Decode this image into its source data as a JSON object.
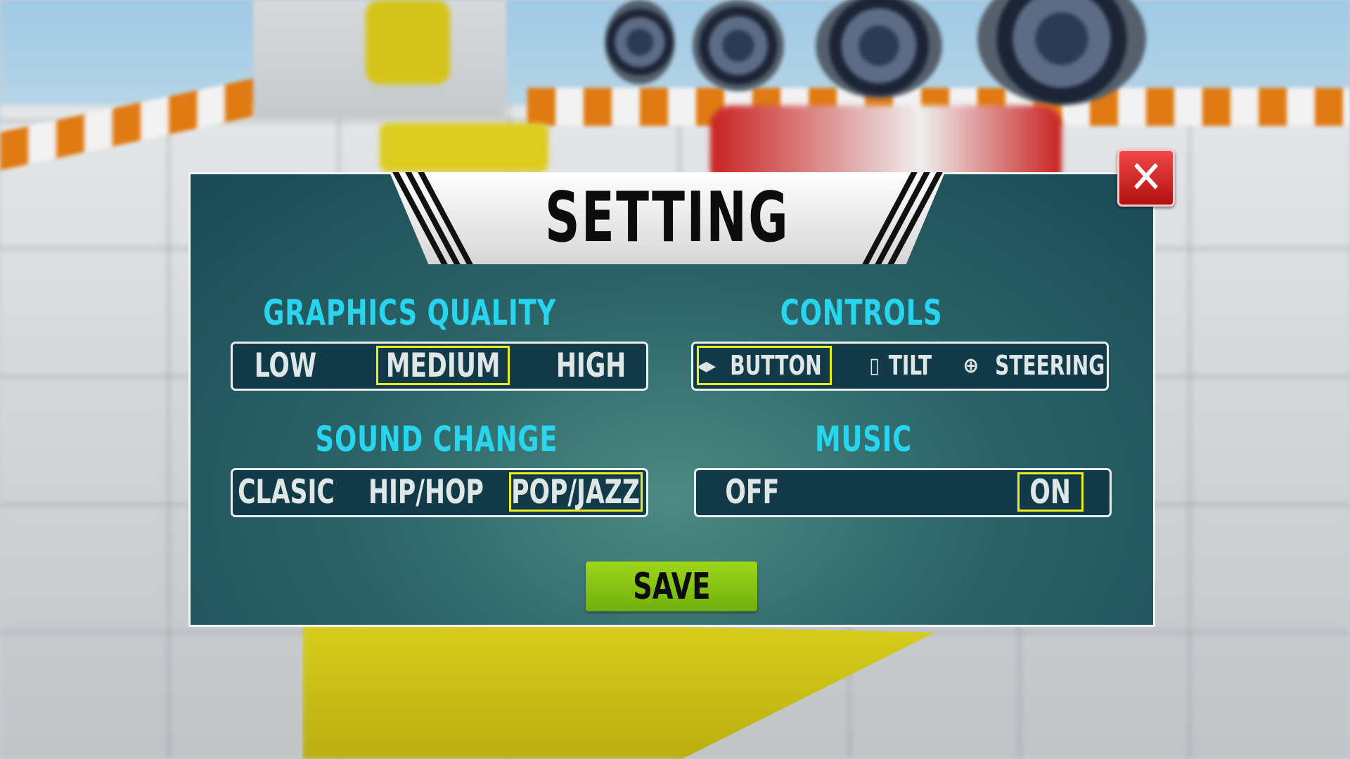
{
  "dialog": {
    "title": "SETTING",
    "close_icon": "x-icon"
  },
  "graphics": {
    "title": "GRAPHICS QUALITY",
    "options": [
      "LOW",
      "MEDIUM",
      "HIGH"
    ],
    "selected": "MEDIUM"
  },
  "controls": {
    "title": "CONTROLS",
    "options": [
      "BUTTON",
      "TILT",
      "STEERING"
    ],
    "icons": [
      "arrows-icon",
      "phone-tilt-icon",
      "steering-wheel-icon"
    ],
    "selected": "BUTTON"
  },
  "sound": {
    "title": "SOUND CHANGE",
    "options": [
      "CLASIC",
      "HIP/HOP",
      "POP/JAZZ"
    ],
    "selected": "POP/JAZZ"
  },
  "music": {
    "title": "MUSIC",
    "options": [
      "OFF",
      "ON"
    ],
    "selected": "ON"
  },
  "save_label": "SAVE",
  "colors": {
    "accent_title": "#27d6ee",
    "selected_border": "#e9ee1a",
    "save_button": "#8cc815",
    "close_button": "#d92424"
  }
}
